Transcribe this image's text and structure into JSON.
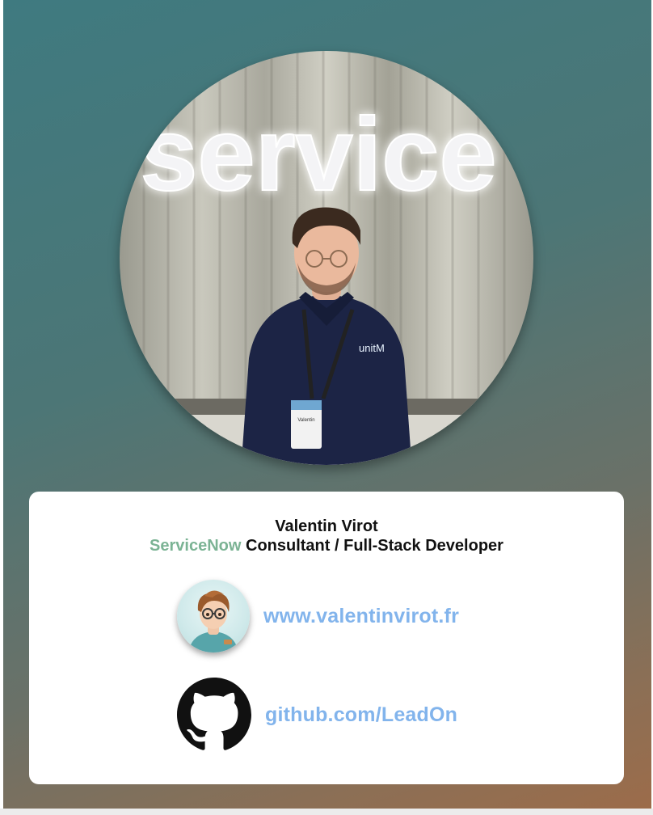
{
  "photo": {
    "sign_text": "service",
    "badge_text": "Valentin",
    "shirt_logo_text": "unitM"
  },
  "profile": {
    "name": "Valentin Virot",
    "title_brand": "ServiceNow",
    "title_rest": " Consultant / Full-Stack Developer"
  },
  "links": [
    {
      "label": "www.valentinvirot.fr",
      "icon": "avatar-icon"
    },
    {
      "label": "github.com/LeadOn",
      "icon": "github-icon"
    }
  ],
  "colors": {
    "brand": "#7bb394",
    "link": "#82b4ec",
    "card": "#ffffff"
  }
}
